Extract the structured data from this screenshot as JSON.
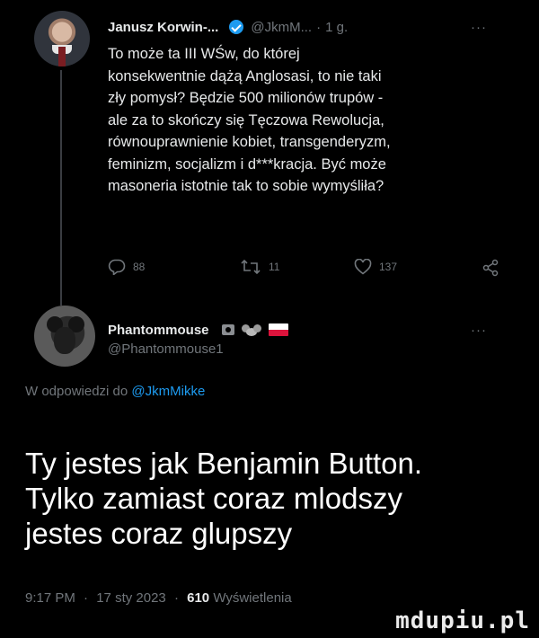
{
  "tweet": {
    "author_name": "Janusz Korwin-...",
    "author_handle": "@JkmM...",
    "separator": "·",
    "age": "1 g.",
    "more": "···",
    "body_lines": [
      "To może ta III WŚw, do której",
      "konsekwentnie dążą Anglosasi, to nie taki",
      "zły pomysł? Będzie 500 milionów trupów -",
      "ale za to skończy się Tęczowa Rewolucja,",
      "równouprawnienie kobiet, transgenderyzm,",
      "feminizm, socjalizm i d***kracja. Być może",
      "masoneria istotnie tak to sobie wymyśliła?"
    ],
    "actions": {
      "replies": "88",
      "retweets": "11",
      "likes": "137"
    }
  },
  "reply": {
    "author_name": "Phantommouse",
    "author_handle": "@Phantommouse1",
    "more": "···",
    "replying_prefix": "W odpowiedzi do",
    "replying_mention": "@JkmMikke",
    "body_lines": [
      "Ty jestes jak Benjamin Button.",
      "Tylko zamiast coraz mlodszy",
      "jestes coraz glupszy"
    ],
    "meta": {
      "time": "9:17 PM",
      "date": "17 sty 2023",
      "separator": "·",
      "views_count": "610",
      "views_label": "Wyświetlenia"
    }
  },
  "watermark": "mdupiu.pl",
  "colors": {
    "background": "#000000",
    "text": "#e7e9ea",
    "muted": "#71767b",
    "accent": "#1d9bf0"
  }
}
